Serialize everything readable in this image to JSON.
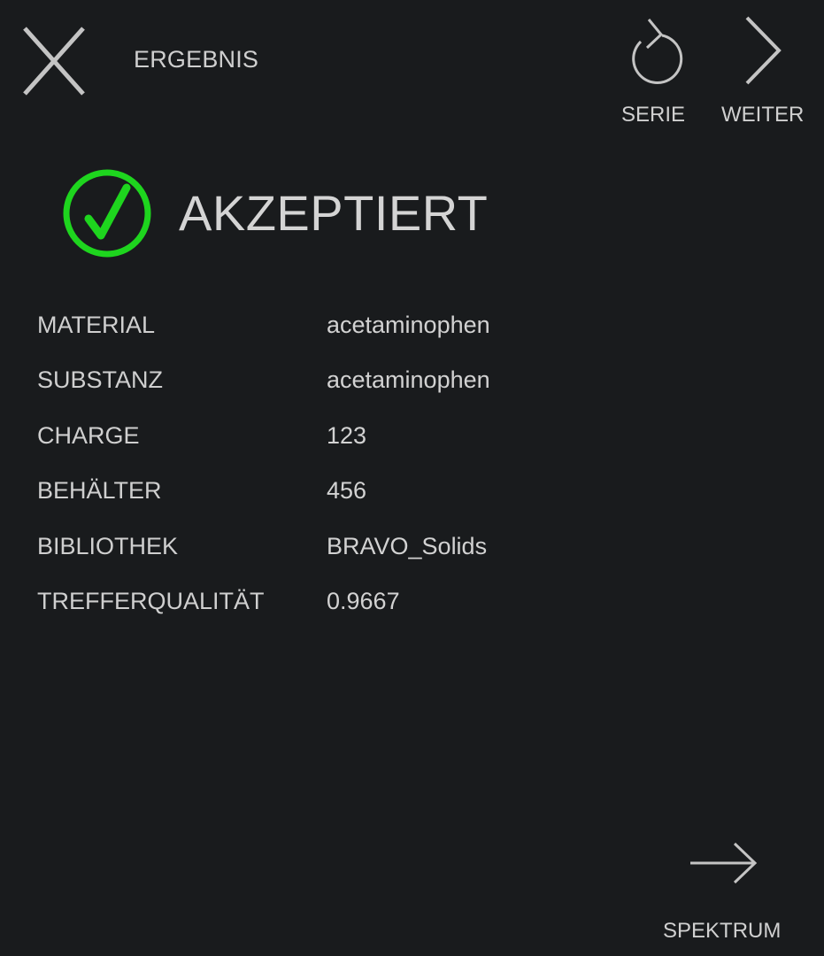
{
  "header": {
    "title": "ERGEBNIS",
    "close_icon": "close-icon",
    "serie": {
      "label": "SERIE",
      "icon": "undo-icon"
    },
    "weiter": {
      "label": "WEITER",
      "icon": "chevron-right-icon"
    }
  },
  "status": {
    "text": "AKZEPTIERT",
    "icon": "check-circle-icon",
    "color": "#1ed51e"
  },
  "details": [
    {
      "label": "MATERIAL",
      "value": "acetaminophen"
    },
    {
      "label": "SUBSTANZ",
      "value": "acetaminophen"
    },
    {
      "label": "CHARGE",
      "value": "123"
    },
    {
      "label": "BEHÄLTER",
      "value": "456"
    },
    {
      "label": "BIBLIOTHEK",
      "value": "BRAVO_Solids"
    },
    {
      "label": "TREFFERQUALITÄT",
      "value": "0.9667"
    }
  ],
  "footer": {
    "spektrum": {
      "label": "SPEKTRUM",
      "icon": "arrow-right-icon"
    }
  },
  "colors": {
    "background": "#191b1d",
    "text": "#cfcfcf",
    "accent": "#1ed51e"
  }
}
